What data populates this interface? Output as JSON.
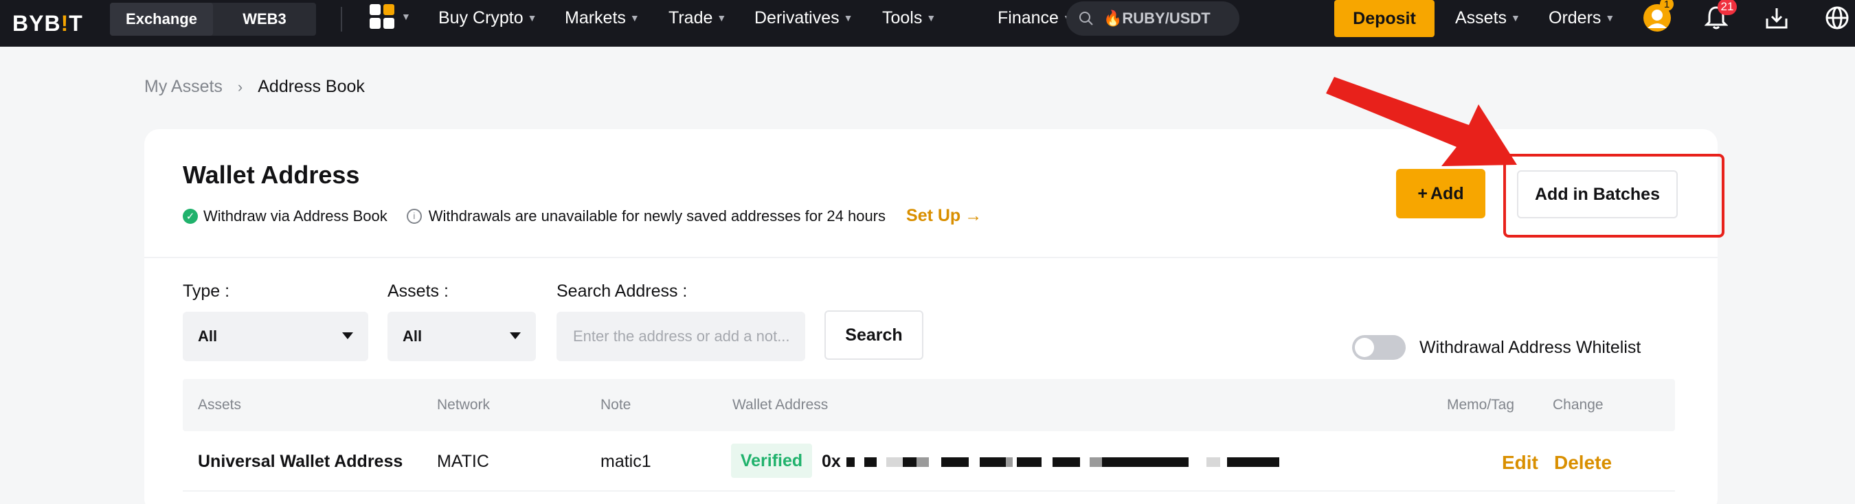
{
  "nav": {
    "logo_left": "BYB",
    "logo_mid": "!",
    "logo_right": "T",
    "switch": [
      "Exchange",
      "WEB3"
    ],
    "menu": [
      "Buy Crypto",
      "Markets",
      "Trade",
      "Derivatives",
      "Tools",
      "Finance"
    ],
    "search_text": "🔥RUBY/USDT",
    "deposit": "Deposit",
    "right_menu": [
      "Assets",
      "Orders"
    ],
    "avatar_badge": "1",
    "notif_badge": "21"
  },
  "breadcrumb": {
    "parent": "My Assets",
    "current": "Address Book"
  },
  "card": {
    "title": "Wallet Address",
    "info_check": "Withdraw via Address Book",
    "info_note": "Withdrawals are unavailable for newly saved addresses for 24 hours",
    "setup": "Set Up",
    "add": "Add",
    "add_batches": "Add in Batches"
  },
  "filters": {
    "type_label": "Type :",
    "type_value": "All",
    "assets_label": "Assets :",
    "assets_value": "All",
    "search_label": "Search Address :",
    "search_placeholder": "Enter the address or add a not...",
    "search_button": "Search",
    "whitelist_label": "Withdrawal Address Whitelist"
  },
  "table": {
    "headers": [
      "Assets",
      "Network",
      "Note",
      "Wallet Address",
      "Memo/Tag",
      "Change"
    ],
    "rows": [
      {
        "asset": "Universal Wallet Address",
        "network": "MATIC",
        "note": "matic1",
        "status": "Verified",
        "address_prefix": "0x",
        "edit": "Edit",
        "delete": "Delete"
      }
    ]
  },
  "colors": {
    "accent": "#f7a600",
    "highlight": "#e8211b",
    "verified": "#20b26c"
  }
}
